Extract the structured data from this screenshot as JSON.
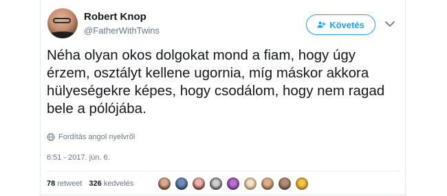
{
  "author": {
    "name": "Robert Knop",
    "handle": "@FatherWithTwins"
  },
  "actions": {
    "follow_label": "Követés"
  },
  "tweet": {
    "text": "Néha olyan okos dolgokat mond a fiam, hogy úgy érzem, osztályt kellene ugornia, míg máskor akkora hülyeségekre képes, hogy csodálom, hogy nem ragad bele a pólójába.",
    "translate_label": "Fordítás angol nyelvről",
    "timestamp": "6:51 - 2017. jún. 6."
  },
  "stats": {
    "retweets_count": "78",
    "retweets_label": "retweet",
    "likes_count": "326",
    "likes_label": "kedvelés"
  },
  "icons": {
    "follow": "user-plus-icon",
    "more": "chevron-down-icon",
    "translate": "globe-icon"
  },
  "colors": {
    "accent": "#1da1f2",
    "muted": "#657786",
    "text": "#14171a"
  }
}
